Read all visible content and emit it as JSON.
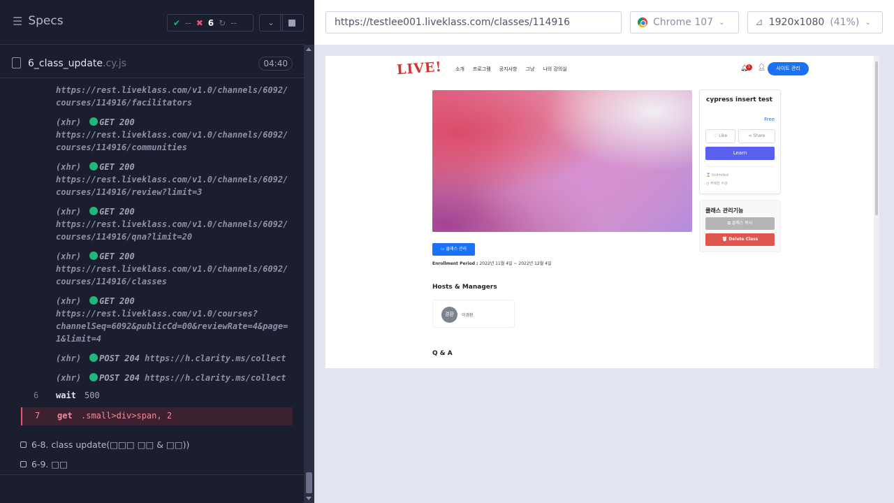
{
  "runner": {
    "title": "Specs",
    "stats": {
      "passed": "--",
      "failed": "6",
      "pending": "--"
    },
    "spec_file": {
      "name": "6_class_update",
      "ext": ".cy.js",
      "duration": "04:40"
    },
    "xhr_entries": [
      {
        "kind": "(xhr)",
        "method": "GET 200",
        "line1": "https://rest.liveklass.com/v1.0/channels/6092/",
        "line2": "courses/114916/facilitators",
        "partial": true
      },
      {
        "kind": "(xhr)",
        "method": "GET 200",
        "line1": "https://rest.liveklass.com/v1.0/channels/6092/",
        "line2": "courses/114916/communities"
      },
      {
        "kind": "(xhr)",
        "method": "GET 200",
        "line1": "https://rest.liveklass.com/v1.0/channels/6092/",
        "line2": "courses/114916/review?limit=3"
      },
      {
        "kind": "(xhr)",
        "method": "GET 200",
        "line1": "https://rest.liveklass.com/v1.0/channels/6092/",
        "line2": "courses/114916/qna?limit=20"
      },
      {
        "kind": "(xhr)",
        "method": "GET 200",
        "line1": "https://rest.liveklass.com/v1.0/channels/6092/",
        "line2": "courses/114916/classes"
      },
      {
        "kind": "(xhr)",
        "method": "GET 200",
        "line1": "https://rest.liveklass.com/v1.0/courses?",
        "line2": "channelSeq=6092&publicCd=00&reviewRate=4&page=",
        "line3": "1&limit=4"
      },
      {
        "kind": "(xhr)",
        "method": "POST 204",
        "line1": "https://h.clarity.ms/collect"
      },
      {
        "kind": "(xhr)",
        "method": "POST 204",
        "line1": "https://h.clarity.ms/collect"
      }
    ],
    "commands": [
      {
        "num": "6",
        "name": "wait",
        "arg": "500",
        "status": "passed"
      },
      {
        "num": "7",
        "name": "get",
        "arg": ".small>div>span, 2",
        "status": "failed"
      }
    ],
    "tests": [
      {
        "label": "6-8. class update(□□□ □□ & □□))"
      },
      {
        "label": "6-9. □□"
      }
    ]
  },
  "browser": {
    "url": "https://testlee001.liveklass.com/classes/114916",
    "browser_name": "Chrome 107",
    "viewport": "1920x1080",
    "scale": "(41%)"
  },
  "page": {
    "logo": "LIVE!",
    "nav": [
      "소개",
      "프로그램",
      "공지사항",
      "그냥",
      "나의 강의실"
    ],
    "notification_count": "1",
    "admin_button": "사이트 관리",
    "course": {
      "title": "cypress insert test",
      "price": "Free",
      "like": "Like",
      "share": "Share",
      "learn": "Learn",
      "meta1": "Unlimited",
      "meta2": "무제한 수강"
    },
    "management": {
      "heading": "클래스 관리기능",
      "copy_button": "클래스 복사",
      "delete_button": "Delete Class"
    },
    "class_mgmt_button": "클래스 관리",
    "enrollment_label": "Enrollment Period :",
    "enrollment_value": "2022년 11월 4일 ~ 2022년 12월 4일",
    "hosts_heading": "Hosts & Managers",
    "host": {
      "avatar": "경환",
      "name": "이경환"
    },
    "qa_heading": "Q & A"
  },
  "colors": {
    "runner_bg": "#1b1e2e",
    "pass": "#1fb77b",
    "fail": "#e45770",
    "primary": "#1971f5",
    "learn": "#5a60f0",
    "danger": "#e0564c"
  }
}
